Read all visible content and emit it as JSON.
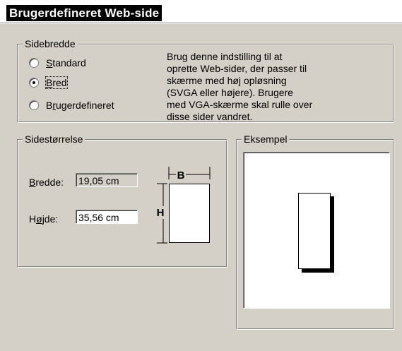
{
  "header": {
    "title": "Brugerdefineret Web-side"
  },
  "sidebredde": {
    "legend": "Sidebredde",
    "options": [
      {
        "label_pre": "",
        "label_u": "S",
        "label_post": "tandard",
        "checked": false
      },
      {
        "label_pre": "",
        "label_u": "B",
        "label_post": "red",
        "checked": true
      },
      {
        "label_pre": "B",
        "label_u": "r",
        "label_post": "ugerdefineret",
        "checked": false
      }
    ],
    "description": "Brug denne indstilling til at oprette Web-sider, der passer til skærme med høj opløsning (SVGA eller højere). Brugere med VGA-skærme skal rulle over disse sider vandret."
  },
  "sidestorrelse": {
    "legend": "Sidestørrelse",
    "width_label_u": "B",
    "width_label_post": "redde:",
    "width_value": "19,05 cm",
    "height_label_pre": "H",
    "height_label_u": "ø",
    "height_label_post": "jde:",
    "height_value": "35,56 cm",
    "diagram_b": "B",
    "diagram_h": "H"
  },
  "eksempel": {
    "legend": "Eksempel"
  }
}
